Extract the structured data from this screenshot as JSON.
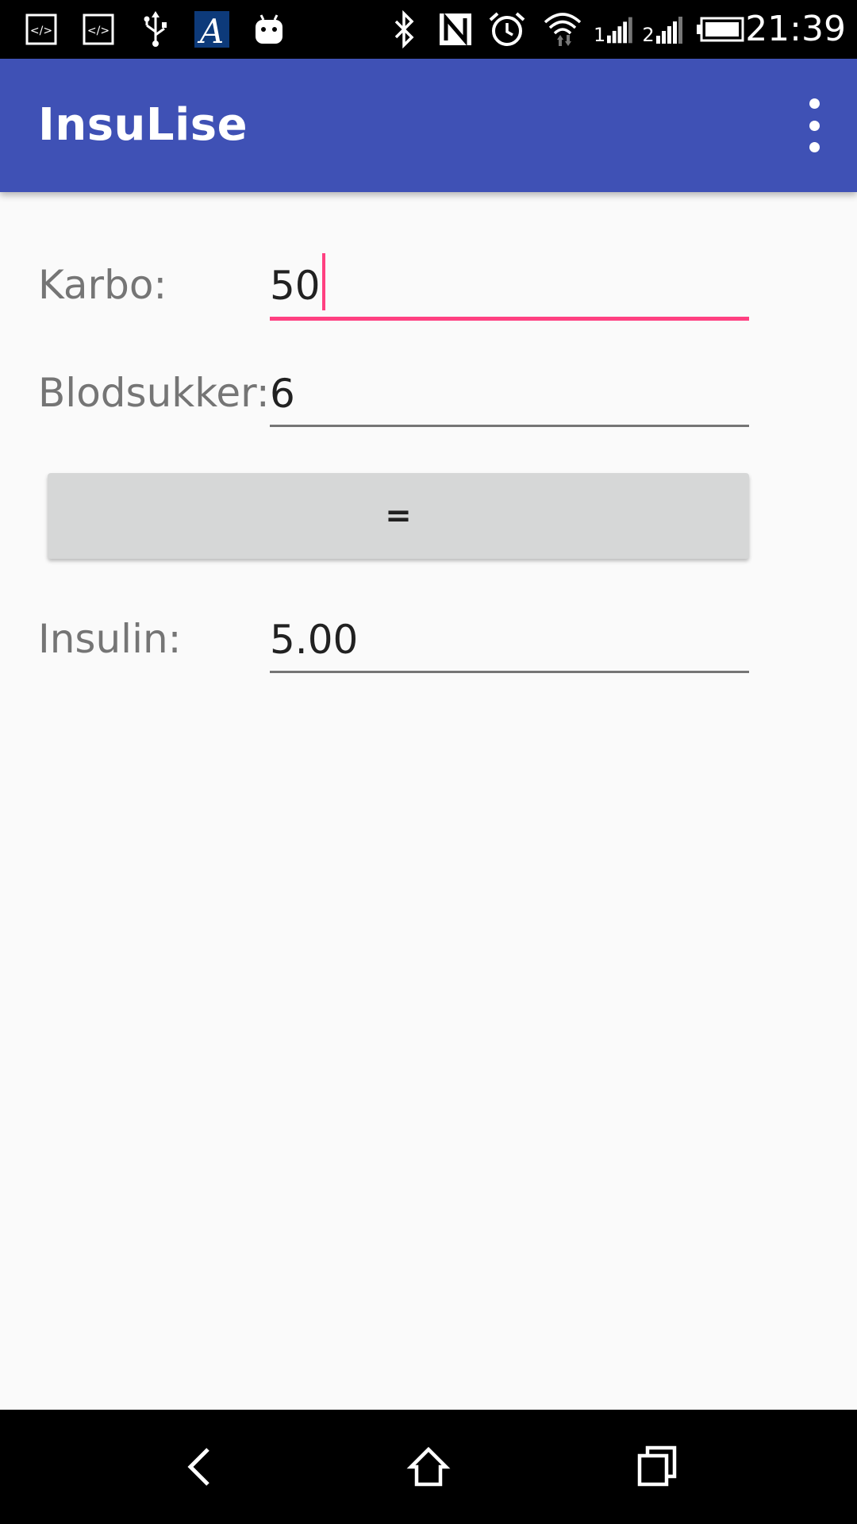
{
  "status_bar": {
    "icons": [
      "code-icon",
      "code-icon",
      "usb-icon",
      "app-icon",
      "android-icon",
      "bluetooth-icon",
      "nfc-icon",
      "alarm-icon",
      "wifi-icon",
      "signal-icon",
      "signal-icon",
      "battery-icon"
    ],
    "signal_label_1": "1",
    "signal_label_2": "2",
    "time": "21:39"
  },
  "app_bar": {
    "title": "InsuLise",
    "menu_icon": "more-vert-icon",
    "color": "#3f51b5"
  },
  "form": {
    "karbo": {
      "label": "Karbo:",
      "value": "50",
      "focused": true
    },
    "blodsukker": {
      "label": "Blodsukker:",
      "value": "6"
    },
    "calculate_button": {
      "label": "="
    },
    "insulin": {
      "label": "Insulin:",
      "value": "5.00"
    }
  },
  "nav_bar": {
    "back": "back-icon",
    "home": "home-icon",
    "recents": "recents-icon"
  },
  "colors": {
    "primary": "#3f51b5",
    "accent": "#ff4081",
    "background": "#fafafa",
    "button": "#d6d7d7"
  }
}
